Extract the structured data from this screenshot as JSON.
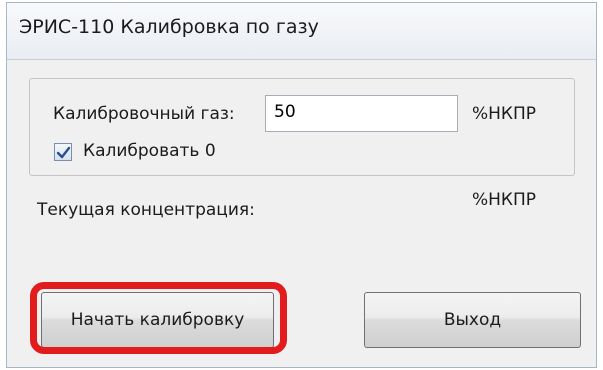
{
  "window": {
    "title": "ЭРИС-110 Калибровка по газу"
  },
  "calibration_gas": {
    "label": "Калибровочный газ:",
    "value": "50",
    "unit": "%НКПР"
  },
  "calibrate_zero": {
    "label": "Калибровать 0",
    "checked": true
  },
  "current_concentration": {
    "label": "Текущая концентрация:",
    "unit": "%НКПР"
  },
  "buttons": {
    "start": "Начать калибровку",
    "exit": "Выход"
  },
  "colors": {
    "highlight": "#e21c1c",
    "checkbox_check": "#2a4f8c"
  }
}
